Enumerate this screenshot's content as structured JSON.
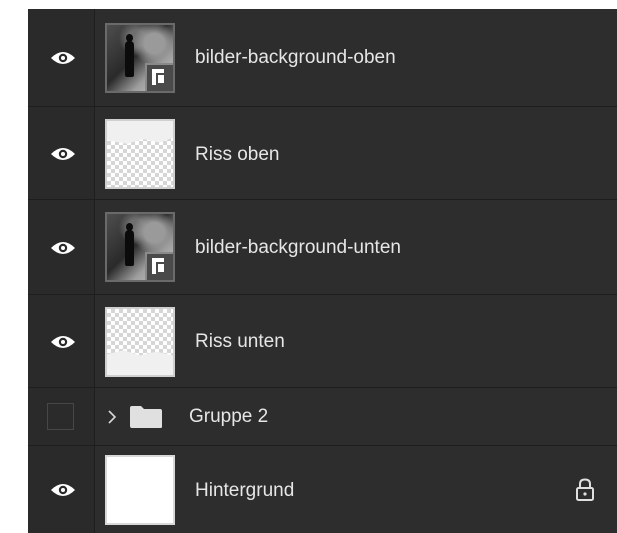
{
  "layers_panel": {
    "layers": [
      {
        "name": "bilder-background-oben",
        "visible": true,
        "thumb": "smart-object-photo",
        "icon": "eye-icon"
      },
      {
        "name": "Riss oben",
        "visible": true,
        "thumb": "transparent-top-edge",
        "icon": "eye-icon"
      },
      {
        "name": "bilder-background-unten",
        "visible": true,
        "thumb": "smart-object-photo",
        "icon": "eye-icon"
      },
      {
        "name": "Riss unten",
        "visible": true,
        "thumb": "transparent-bottom-edge",
        "icon": "eye-icon"
      },
      {
        "name": "Gruppe 2",
        "visible": false,
        "type": "group",
        "collapsed": true,
        "icons": [
          "chevron-right-icon",
          "folder-icon"
        ]
      },
      {
        "name": "Hintergrund",
        "visible": true,
        "thumb": "white",
        "locked": true,
        "icons": [
          "eye-icon",
          "lock-icon"
        ]
      }
    ]
  },
  "colors": {
    "panel_bg": "#2d2d2d",
    "text": "#e6e6e6",
    "divider": "#1e1e1e"
  }
}
